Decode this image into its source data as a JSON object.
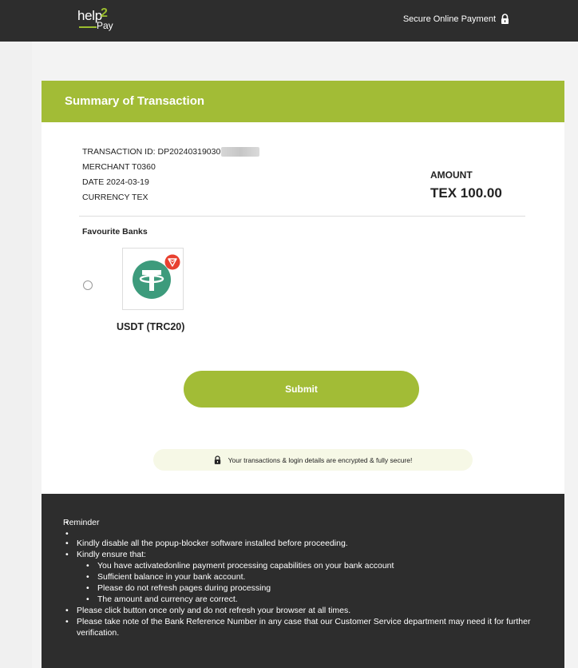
{
  "header": {
    "logo": {
      "word_top": "help",
      "digit": "2",
      "word_bottom": "Pay"
    },
    "secure_text": "Secure Online Payment",
    "lock_icon": "lock-icon"
  },
  "summary": {
    "title": "Summary of Transaction",
    "transaction_id": "TRANSACTION ID: DP20240319030",
    "merchant": "MERCHANT T0360",
    "date": "DATE 2024-03-19",
    "currency": "CURRENCY TEX",
    "amount_label": "AMOUNT",
    "amount_value": "TEX 100.00"
  },
  "banks": {
    "label": "Favourite Banks",
    "items": [
      {
        "name": "USDT (TRC20)",
        "icon": "tether-icon",
        "selected": false
      }
    ]
  },
  "submit_label": "Submit",
  "secure_note": "Your transactions & login details are encrypted & fully secure!",
  "reminder": {
    "title": "Reminder",
    "items": [
      "Kindly disable all the popup-blocker software installed before proceeding.",
      "Kindly ensure that:",
      "Please click button once only and do not refresh your browser at all times.",
      "Please take note of the Bank Reference Number in any case that our Customer Service department may need it for further verification."
    ],
    "sub_items": [
      "You have activatedonline payment processing capabilities on your bank account",
      "Sufficient balance in your bank account.",
      "Please do not refresh pages during processing",
      "The amount and currency are correct."
    ]
  },
  "colors": {
    "accent": "#a2bc36",
    "dark": "#2d2d2d",
    "tether": "#3d9b7c",
    "badge": "#e8402f"
  }
}
